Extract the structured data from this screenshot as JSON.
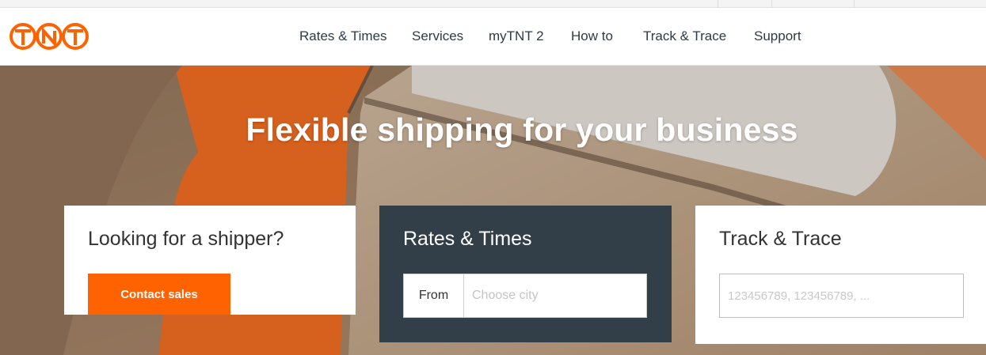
{
  "brand": {
    "logo_text": "TNT",
    "accent": "#ff6200",
    "dark_panel": "#323e48"
  },
  "nav": {
    "items": [
      {
        "label": "Rates & Times"
      },
      {
        "label": "Services"
      },
      {
        "label": "myTNT 2"
      },
      {
        "label": "How to"
      },
      {
        "label": "Track & Trace"
      },
      {
        "label": "Support"
      }
    ]
  },
  "hero": {
    "title": "Flexible shipping for your business"
  },
  "shipper_card": {
    "title": "Looking for a shipper?",
    "button_label": "Contact sales"
  },
  "rates_card": {
    "title": "Rates & Times",
    "from_label": "From",
    "from_placeholder": "Choose city",
    "from_value": ""
  },
  "track_card": {
    "title": "Track & Trace",
    "input_placeholder": "123456789, 123456789, ...",
    "input_value": ""
  }
}
